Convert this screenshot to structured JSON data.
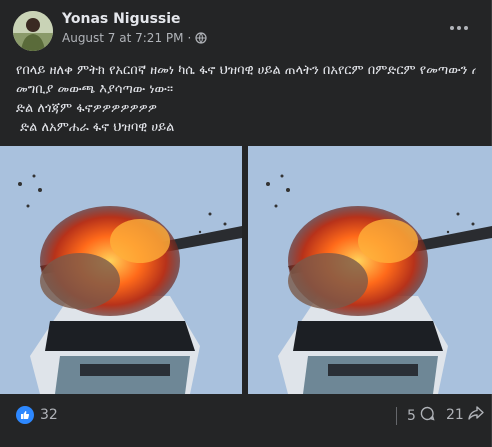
{
  "post": {
    "author": "Yonas Nigussie",
    "timestamp": "August 7 at 7:21 PM",
    "separator": "·",
    "privacy_icon": "globe-icon",
    "more_icon": "more-options-icon",
    "text_lines": [
      "የበላይ ዘለቀ ምትክ የአርበኛ ዘመነ ካሴ ፋኖ ህዝባዊ ሀይል ጠላትን በአየርም በምድርም የመጣውን ጠላት",
      "መግቢያ መውጫ እያሳጣው ነው።",
      "ድል ለጎጃም ፋኖዎዎዎዎዎዎዎ",
      " ድል ለአምሐራ ፋኖ ህዝባዊ ሀይል"
    ],
    "images": [
      "helicopter-explosion-image",
      "helicopter-explosion-image"
    ]
  },
  "reactions": {
    "like_count": "32",
    "comment_count": "5",
    "share_count": "21",
    "like_color": "#2d88ff"
  },
  "colors": {
    "background": "#242526",
    "text_primary": "#e4e6eb",
    "text_secondary": "#b0b3b8"
  }
}
